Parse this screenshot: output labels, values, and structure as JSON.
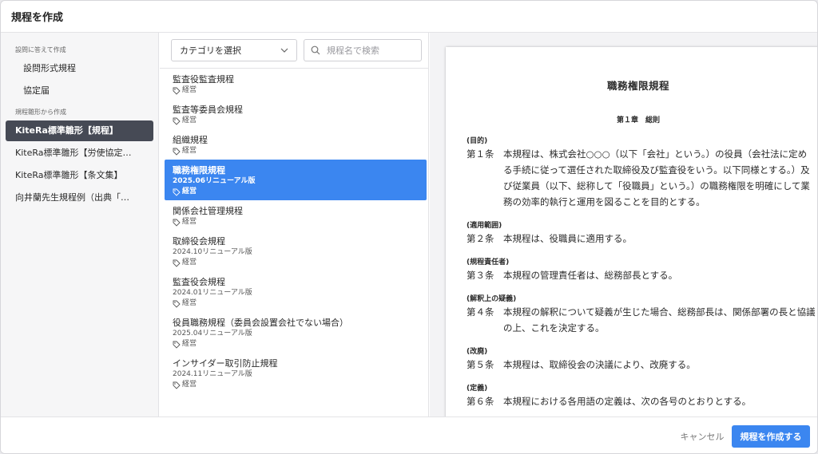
{
  "dialog": {
    "title": "規程を作成"
  },
  "sidebar": {
    "section1": "設問に答えて作成",
    "items1": [
      {
        "label": "設問形式規程"
      },
      {
        "label": "協定届"
      }
    ],
    "section2": "規程雛形から作成",
    "items2": [
      {
        "label": "KiteRa標準雛形【規程】",
        "selected": true
      },
      {
        "label": "KiteRa標準雛形【労使協定…"
      },
      {
        "label": "KiteRa標準雛形【条文集】"
      },
      {
        "label": "向井蘭先生規程例（出典「…"
      }
    ]
  },
  "filters": {
    "category_select": "カテゴリを選択",
    "search_placeholder": "規程名で検索"
  },
  "documents": [
    {
      "title": "監査役監査規程",
      "tag": "経営"
    },
    {
      "title": "監査等委員会規程",
      "tag": "経営"
    },
    {
      "title": "組織規程",
      "tag": "経営"
    },
    {
      "title": "職務権限規程",
      "subtitle": "2025.06リニューアル版",
      "tag": "経営",
      "selected": true
    },
    {
      "title": "関係会社管理規程",
      "tag": "経営"
    },
    {
      "title": "取締役会規程",
      "subtitle": "2024.10リニューアル版",
      "tag": "経営"
    },
    {
      "title": "監査役会規程",
      "subtitle": "2024.01リニューアル版",
      "tag": "経営"
    },
    {
      "title": "役員職務規程（委員会設置会社でない場合）",
      "subtitle": "2025.04リニューアル版",
      "tag": "経営"
    },
    {
      "title": "インサイダー取引防止規程",
      "subtitle": "2024.11リニューアル版",
      "tag": "経営"
    }
  ],
  "preview": {
    "title": "職務権限規程",
    "chapter": "第１章　総則",
    "sections": [
      {
        "heading": "(目的)",
        "number": "第１条",
        "lines": [
          "本規程は、株式会社○○○（以下「会社」という。）の役員（会社法に定め",
          "る手続に従って選任された取締役及び監査役をいう。以下同様とする。）及",
          "び従業員（以下、総称して「役職員」という。）の職務権限を明確にして業",
          "務の効率的執行と運用を図ることを目的とする。"
        ]
      },
      {
        "heading": "(適用範囲)",
        "number": "第２条",
        "lines": [
          "本規程は、役職員に適用する。"
        ]
      },
      {
        "heading": "(規程責任者)",
        "number": "第３条",
        "lines": [
          "本規程の管理責任者は、総務部長とする。"
        ]
      },
      {
        "heading": "(解釈上の疑義)",
        "number": "第４条",
        "lines": [
          "本規程の解釈について疑義が生じた場合、総務部長は、関係部署の長と協議",
          "の上、これを決定する。"
        ]
      },
      {
        "heading": "(改廃)",
        "number": "第５条",
        "lines": [
          "本規程は、取締役会の決議により、改廃する。"
        ]
      },
      {
        "heading": "(定義)",
        "number": "第６条",
        "lines": [
          "本規程における各用語の定義は、次の各号のとおりとする。"
        ]
      }
    ]
  },
  "footer": {
    "cancel_label": "キャンセル",
    "create_label": "規程を作成する"
  },
  "colors": {
    "accent": "#3b86f0",
    "sidebar_selected": "#464a55"
  }
}
